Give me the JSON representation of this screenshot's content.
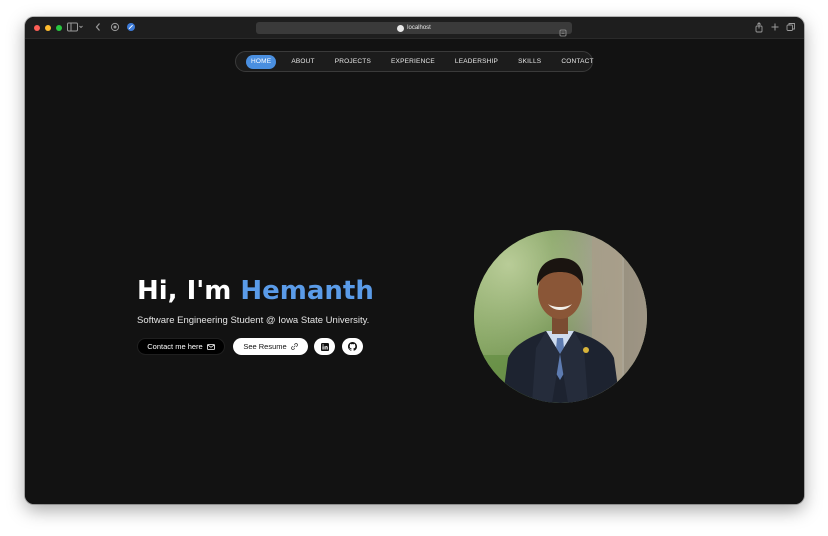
{
  "browser": {
    "url": "localhost"
  },
  "nav": {
    "items": [
      {
        "label": "HOME",
        "active": true
      },
      {
        "label": "ABOUT",
        "active": false
      },
      {
        "label": "PROJECTS",
        "active": false
      },
      {
        "label": "EXPERIENCE",
        "active": false
      },
      {
        "label": "LEADERSHIP",
        "active": false
      },
      {
        "label": "SKILLS",
        "active": false
      },
      {
        "label": "CONTACT",
        "active": false
      }
    ]
  },
  "hero": {
    "greeting": "Hi, I'm ",
    "name": "Hemanth",
    "subtitle": "Software Engineering Student @ Iowa State University.",
    "contact_label": "Contact me here",
    "resume_label": "See Resume"
  },
  "colors": {
    "accent": "#4a8fe0",
    "name": "#5a9be8",
    "background": "#121212"
  },
  "icons": {
    "contact": "mail-icon",
    "resume": "link-icon",
    "linkedin": "linkedin-icon",
    "github": "github-icon"
  }
}
